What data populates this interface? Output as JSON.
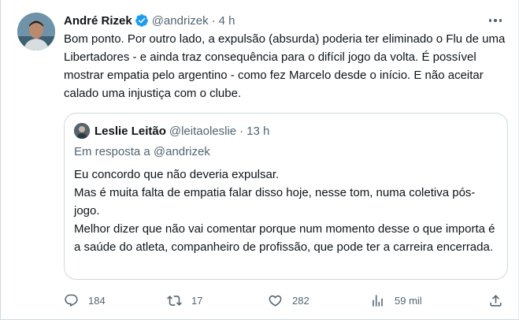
{
  "tweet": {
    "author": {
      "display_name": "André Rizek",
      "handle": "@andrizek",
      "verified": true,
      "avatar_icon": "person-avatar"
    },
    "separator": "·",
    "time": "4 h",
    "more_icon": "more-horizontal-icon",
    "paragraphs": [
      "Bom ponto. Por outro lado, a expulsão (absurda) poderia ter eliminado o Flu de uma Libertadores - e ainda traz consequência para o difícil jogo da volta. É possível mostrar empatia pelo argentino - como fez Marcelo desde o início. E não aceitar calado uma injustiça com o clube."
    ]
  },
  "quote": {
    "author": {
      "display_name": "Leslie Leitão",
      "handle": "@leitaoleslie",
      "avatar_icon": "person-avatar"
    },
    "separator": "·",
    "time": "13 h",
    "reply_to": "Em resposta a @andrizek",
    "lines": [
      "Eu concordo que não deveria expulsar.",
      "Mas é muita falta de empatia falar disso hoje, nesse tom, numa coletiva pós-jogo.",
      "Melhor dizer que não vai comentar porque num momento desse o que importa é a saúde do atleta, companheiro de profissão, que pode ter a carreira encerrada."
    ]
  },
  "actions": {
    "reply": {
      "icon": "reply-icon",
      "count": "184"
    },
    "retweet": {
      "icon": "retweet-icon",
      "count": "17"
    },
    "like": {
      "icon": "heart-icon",
      "count": "282"
    },
    "views": {
      "icon": "views-icon",
      "count": "59 mil"
    },
    "share": {
      "icon": "share-icon"
    }
  },
  "colors": {
    "text": "#0f1419",
    "secondary": "#536471",
    "verified": "#1d9bf0",
    "border": "#cfd9de"
  }
}
